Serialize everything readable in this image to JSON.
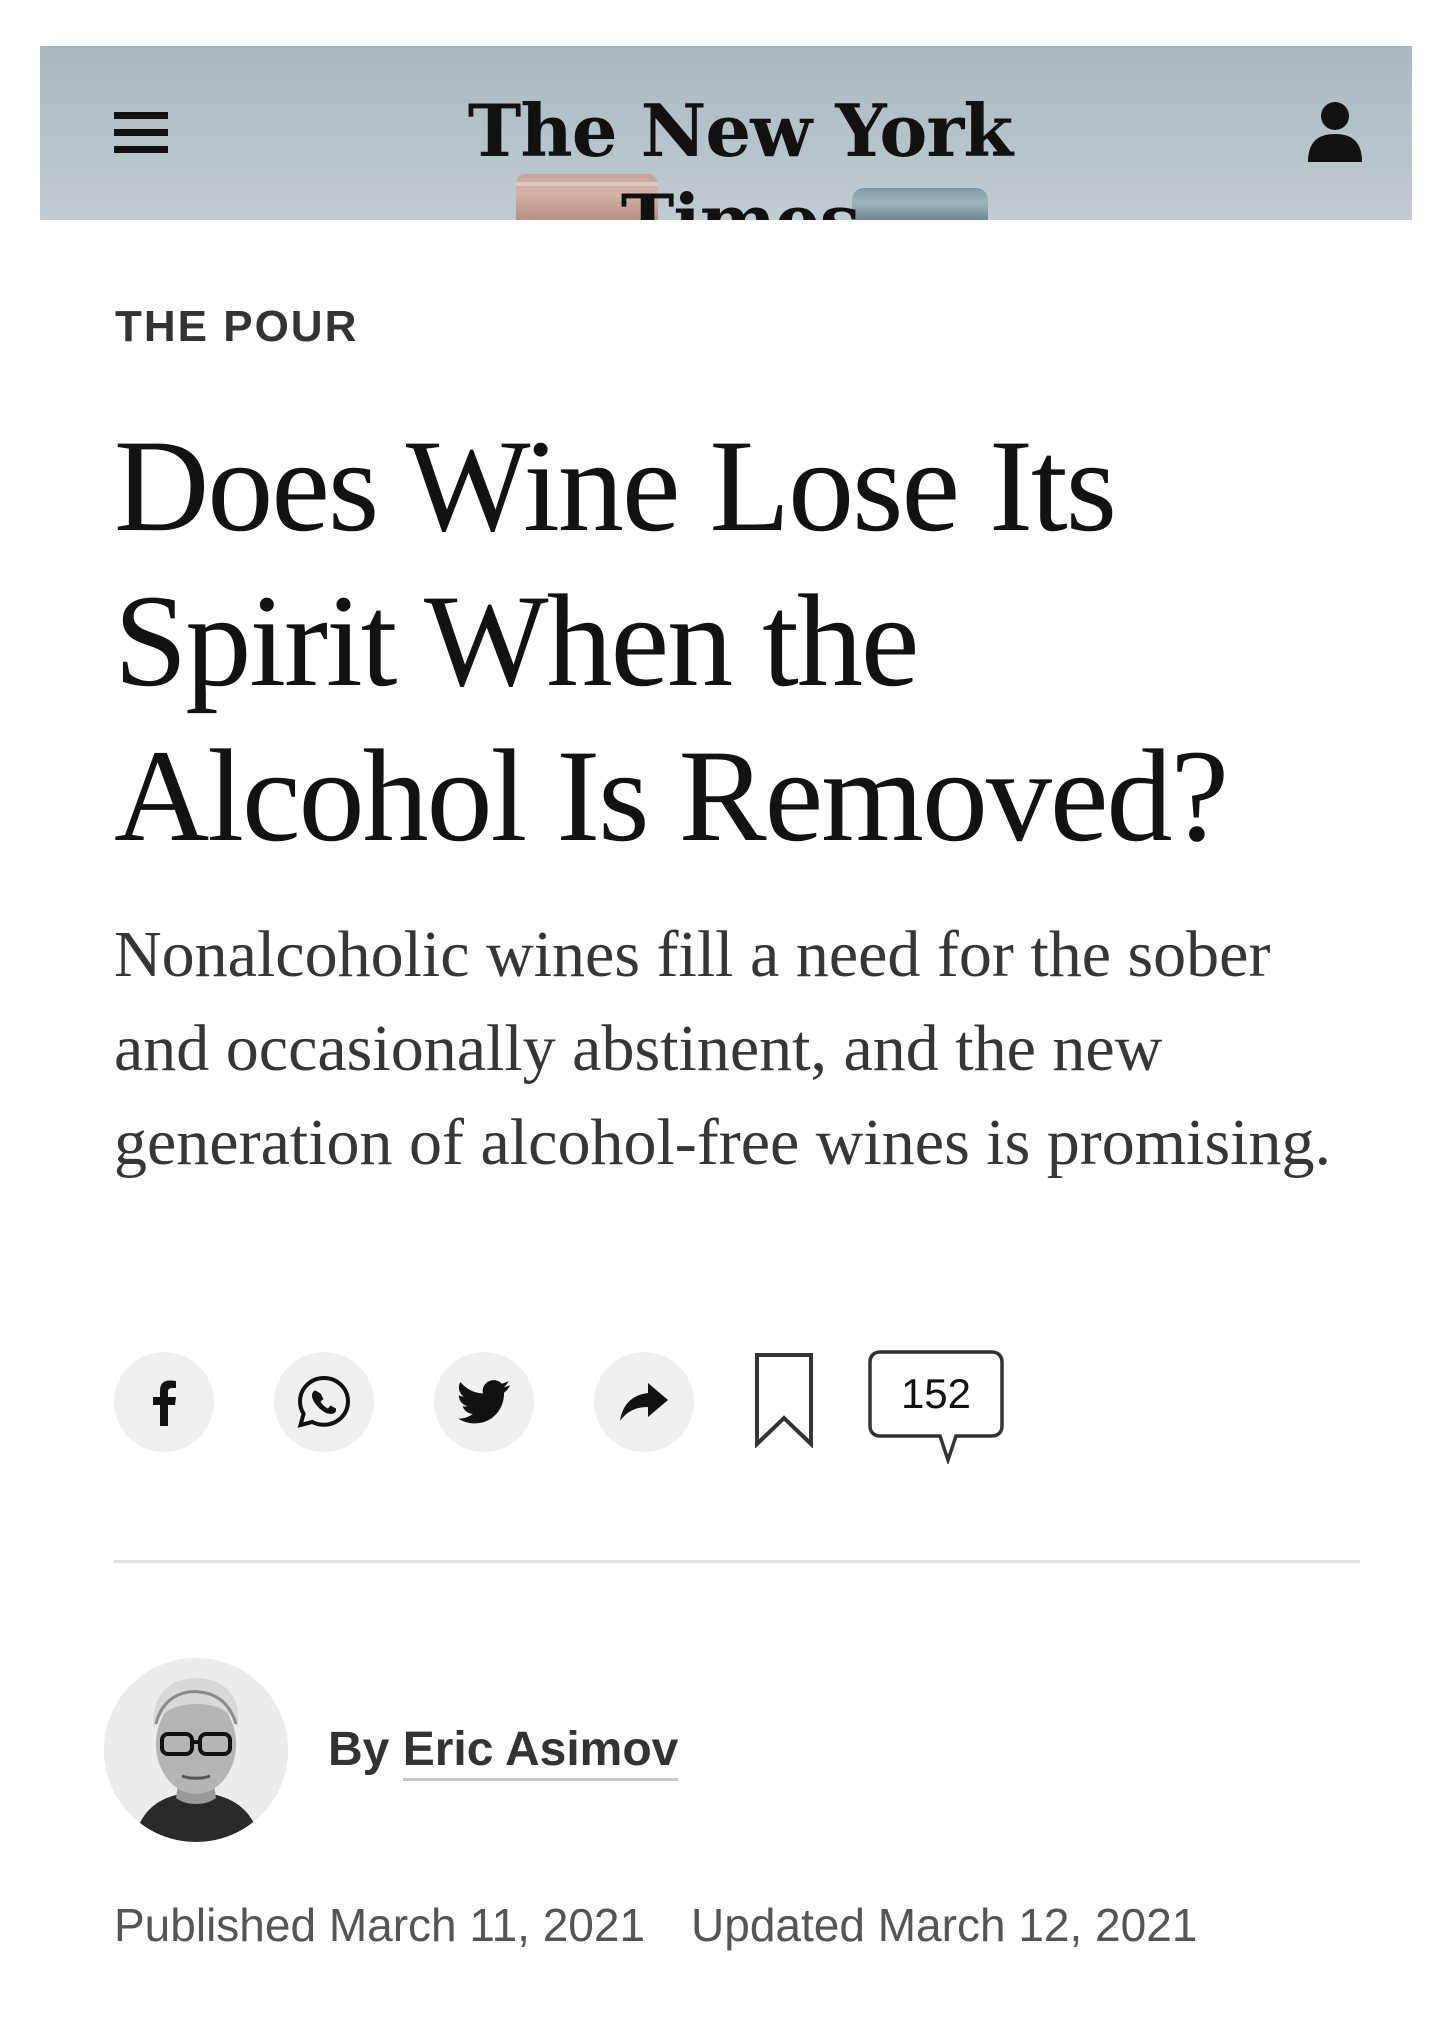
{
  "masthead": {
    "logo_text": "The New York Times",
    "menu_icon": "hamburger-menu-icon",
    "account_icon": "user-account-icon"
  },
  "article": {
    "kicker": "THE POUR",
    "headline_lines": [
      "Does Wine Lose Its",
      "Spirit When the",
      "Alcohol Is Removed?"
    ],
    "summary": "Nonalcoholic wines fill a need for the sober and occasionally abstinent, and the new generation of alcohol-free wines is promising."
  },
  "share_tools": {
    "buttons": [
      {
        "icon": "facebook-icon"
      },
      {
        "icon": "whatsapp-icon"
      },
      {
        "icon": "twitter-icon"
      },
      {
        "icon": "share-arrow-icon"
      }
    ],
    "bookmark_icon": "bookmark-icon",
    "comment_count": "152"
  },
  "byline": {
    "prefix": "By",
    "author": "Eric Asimov"
  },
  "dates": {
    "published": "Published March 11, 2021",
    "updated": "Updated March 12, 2021"
  },
  "colors": {
    "masthead_bg": "#b5c3cb",
    "text": "#121212",
    "share_bg": "#f0f0f0",
    "divider": "#e2e2e2"
  }
}
